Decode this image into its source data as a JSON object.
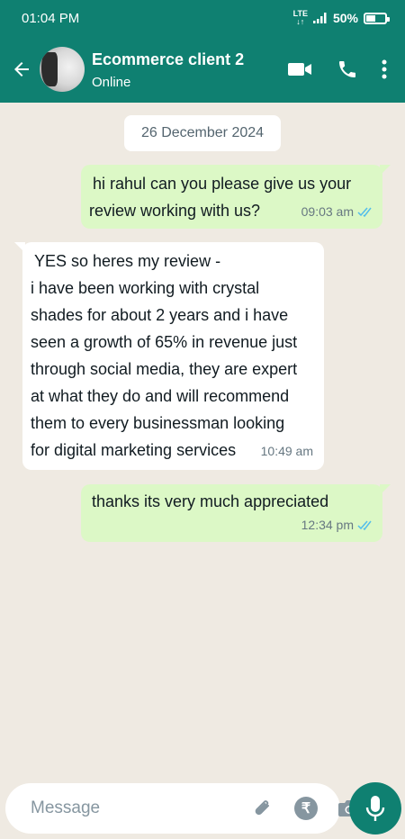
{
  "status_bar": {
    "time": "01:04 PM",
    "network": "LTE",
    "battery": "50%"
  },
  "header": {
    "contact_name": "Ecommerce client 2",
    "contact_status": "Online",
    "icons": [
      "back-arrow-icon",
      "video-call-icon",
      "phone-call-icon",
      "more-options-icon"
    ],
    "color": "#0f8071"
  },
  "chat": {
    "date": "26 December 2024",
    "messages": [
      {
        "direction": "outgoing",
        "lines": [
          "hi rahul can you please give us your",
          "review working with us?"
        ],
        "time": "09:03 am",
        "read": true
      },
      {
        "direction": "incoming",
        "lines": [
          "YES so heres my review -",
          "i have been working with crystal",
          "shades for about 2 years and i have",
          "seen a growth of 65% in revenue just",
          "through social media, they are expert",
          "at what they do and will recommend",
          "them to every businessman looking",
          "for digital marketing services"
        ],
        "time": "10:49 am"
      },
      {
        "direction": "outgoing",
        "lines": [
          "thanks its very much appreciated"
        ],
        "time": "12:34 pm",
        "read": true
      }
    ]
  },
  "composer": {
    "placeholder": "Message",
    "rupee_symbol": "₹",
    "icons": [
      "emoji-icon",
      "attach-icon",
      "payment-icon",
      "camera-icon",
      "mic-icon"
    ]
  }
}
